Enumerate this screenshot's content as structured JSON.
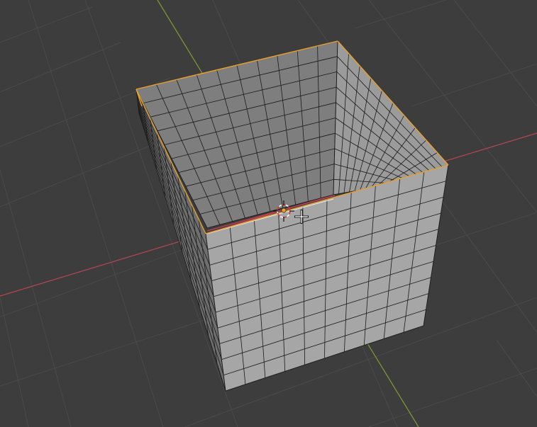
{
  "viewport": {
    "background": "#3d3d3d",
    "grid_color": "#4a4a4a",
    "axis_x_color": "#b8474f",
    "axis_y_color": "#7f9a32"
  },
  "mesh": {
    "object": "cube",
    "subdivisions": 10,
    "outer_face_color": "#a6a6a6",
    "inner_back_face_color": "#7e7e7e",
    "inner_right_face_color": "#9b9b9b",
    "inner_floor_color": "#5b5b5b",
    "left_face_color": "#6f6f6f",
    "wire_color": "#1a1a1a",
    "selected_edge_color": "#e8a12f"
  },
  "cursor": {
    "icon": "3d-cursor-icon",
    "origin_icon": "object-origin-icon",
    "pointer_icon": "crosshair-pointer-icon"
  }
}
